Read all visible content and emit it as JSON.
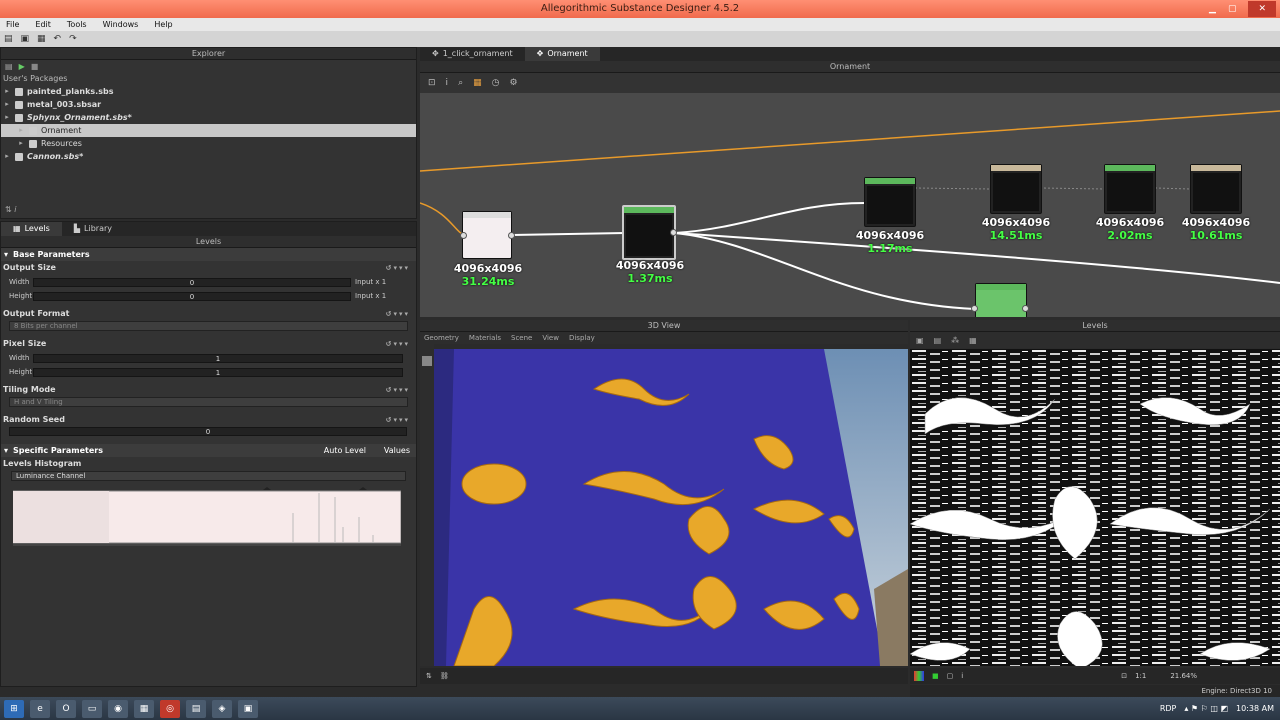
{
  "window": {
    "title": "Allegorithmic Substance Designer 4.5.2"
  },
  "menu": [
    "File",
    "Edit",
    "Tools",
    "Windows",
    "Help"
  ],
  "explorer": {
    "title": "Explorer",
    "root_label": "User's Packages",
    "items": [
      {
        "label": "painted_planks.sbs",
        "indent": 0,
        "selected": false,
        "italic": false
      },
      {
        "label": "metal_003.sbsar",
        "indent": 0,
        "selected": false,
        "italic": false
      },
      {
        "label": "Sphynx_Ornament.sbs*",
        "indent": 0,
        "selected": false,
        "italic": true
      },
      {
        "label": "Ornament",
        "indent": 1,
        "selected": true,
        "italic": false
      },
      {
        "label": "Resources",
        "indent": 1,
        "selected": false,
        "italic": false
      },
      {
        "label": "Cannon.sbs*",
        "indent": 0,
        "selected": false,
        "italic": true
      }
    ]
  },
  "params_panel": {
    "tabs": [
      {
        "label": "Levels",
        "active": true
      },
      {
        "label": "Library",
        "active": false
      }
    ],
    "title": "Levels",
    "base_section": "Base Parameters",
    "output_size": {
      "label": "Output Size",
      "width_label": "Width",
      "width_value": "0",
      "width_suffix": "Input x 1",
      "height_label": "Height",
      "height_value": "0",
      "height_suffix": "Input x 1"
    },
    "output_format": {
      "label": "Output Format",
      "value": "8 Bits per channel"
    },
    "pixel_size": {
      "label": "Pixel Size",
      "width_label": "Width",
      "width_value": "1",
      "height_label": "Height",
      "height_value": "1"
    },
    "tiling_mode": {
      "label": "Tiling Mode",
      "value": "H and V Tiling"
    },
    "random_seed": {
      "label": "Random Seed",
      "value": "0"
    },
    "specific_section": "Specific Parameters",
    "auto_level": "Auto Level",
    "values_btn": "Values",
    "histogram_label": "Levels Histogram",
    "channel": "Luminance Channel"
  },
  "graph": {
    "tabs": [
      {
        "label": "1_click_ornament",
        "active": false
      },
      {
        "label": "Ornament",
        "active": true
      }
    ],
    "title": "Ornament",
    "nodes": [
      {
        "res": "4096x4096",
        "time": "31.24ms"
      },
      {
        "res": "4096x4096",
        "time": "1.37ms"
      },
      {
        "res": "4096x4096",
        "time": "1.17ms"
      },
      {
        "res": "4096x4096",
        "time": "14.51ms"
      },
      {
        "res": "4096x4096",
        "time": "2.02ms"
      },
      {
        "res": "4096x4096",
        "time": "10.61ms"
      }
    ]
  },
  "view3d": {
    "title": "3D View",
    "menu": [
      "Geometry",
      "Materials",
      "Scene",
      "View",
      "Display"
    ]
  },
  "view2d": {
    "title": "Levels",
    "zoom": "21.64%",
    "ratio": "1:1",
    "engine": "Engine: Direct3D 10"
  },
  "taskbar": {
    "time": "10:38 AM",
    "rdp": "RDP"
  }
}
